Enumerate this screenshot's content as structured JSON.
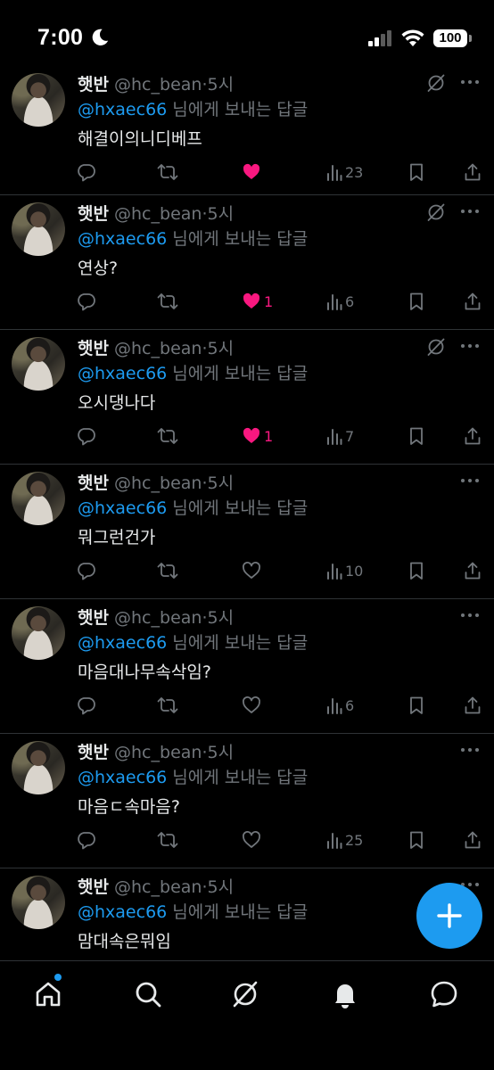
{
  "status_bar": {
    "time": "7:00",
    "battery": "100"
  },
  "tweets": [
    {
      "name": "햇반",
      "handle": "@hc_bean",
      "sep": "·",
      "ago": "5시",
      "reply_prefix": "@hxaec66",
      "reply_suffix": " 님에게 보내는 답글",
      "text": "해결이의니디베프",
      "replies": "",
      "retweets": "",
      "likes": "",
      "liked": true,
      "views": "23",
      "grok": true
    },
    {
      "name": "햇반",
      "handle": "@hc_bean",
      "sep": "·",
      "ago": "5시",
      "reply_prefix": "@hxaec66",
      "reply_suffix": " 님에게 보내는 답글",
      "text": "연상?",
      "replies": "",
      "retweets": "",
      "likes": "1",
      "liked": true,
      "views": "6",
      "grok": true
    },
    {
      "name": "햇반",
      "handle": "@hc_bean",
      "sep": "·",
      "ago": "5시",
      "reply_prefix": "@hxaec66",
      "reply_suffix": " 님에게 보내는 답글",
      "text": "오시댕나다",
      "replies": "",
      "retweets": "",
      "likes": "1",
      "liked": true,
      "views": "7",
      "grok": true
    },
    {
      "name": "햇반",
      "handle": "@hc_bean",
      "sep": "·",
      "ago": "5시",
      "reply_prefix": "@hxaec66",
      "reply_suffix": " 님에게 보내는 답글",
      "text": "뭐그런건가",
      "replies": "",
      "retweets": "",
      "likes": "",
      "liked": false,
      "views": "10",
      "grok": false
    },
    {
      "name": "햇반",
      "handle": "@hc_bean",
      "sep": "·",
      "ago": "5시",
      "reply_prefix": "@hxaec66",
      "reply_suffix": " 님에게 보내는 답글",
      "text": "마음대나무속삭임?",
      "replies": "",
      "retweets": "",
      "likes": "",
      "liked": false,
      "views": "6",
      "grok": false
    },
    {
      "name": "햇반",
      "handle": "@hc_bean",
      "sep": "·",
      "ago": "5시",
      "reply_prefix": "@hxaec66",
      "reply_suffix": " 님에게 보내는 답글",
      "text": "마음ㄷ속마음?",
      "replies": "",
      "retweets": "",
      "likes": "",
      "liked": false,
      "views": "25",
      "grok": false
    },
    {
      "name": "햇반",
      "handle": "@hc_bean",
      "sep": "·",
      "ago": "5시",
      "reply_prefix": "@hxaec66",
      "reply_suffix": " 님에게 보내는 답글",
      "text": "맘대속은뭐임",
      "replies": "",
      "retweets": "",
      "likes": "",
      "liked": false,
      "views": "",
      "grok": false
    }
  ],
  "bottom_nav": [
    {
      "icon": "home-icon"
    },
    {
      "icon": "search-icon"
    },
    {
      "icon": "grok-icon"
    },
    {
      "icon": "notifications-icon"
    },
    {
      "icon": "messages-icon"
    }
  ],
  "colors": {
    "accent": "#1d9bf0",
    "like": "#f91880",
    "muted": "#71767b",
    "text": "#e7e9ea",
    "divider": "#2f3336"
  }
}
